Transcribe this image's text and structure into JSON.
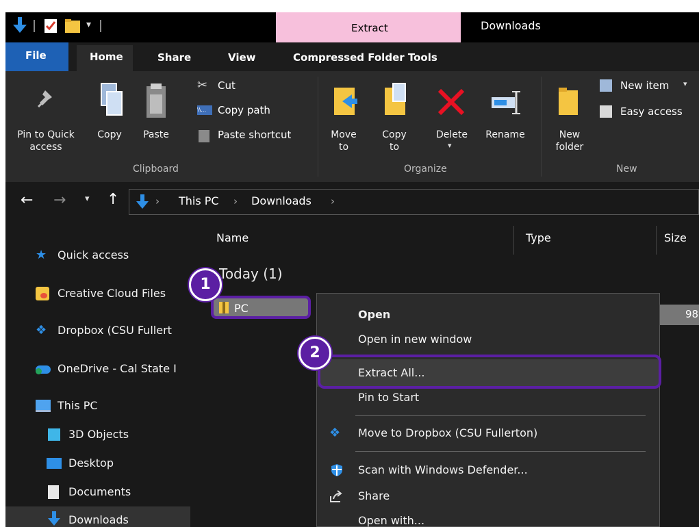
{
  "title_bar": {
    "contextual_tab": "Extract",
    "window_title": "Downloads"
  },
  "tabs": [
    "File",
    "Home",
    "Share",
    "View",
    "Compressed Folder Tools"
  ],
  "ribbon": {
    "pin_label": "Pin to Quick access",
    "copy_label": "Copy",
    "paste_label": "Paste",
    "cut_label": "Cut",
    "copy_path_label": "Copy path",
    "paste_shortcut_label": "Paste shortcut",
    "clipboard_group": "Clipboard",
    "move_to_label": "Move to",
    "copy_to_label": "Copy to",
    "delete_label": "Delete",
    "rename_label": "Rename",
    "organize_group": "Organize",
    "new_folder_label": "New folder",
    "new_item_label": "New item",
    "easy_access_label": "Easy access",
    "new_group": "New"
  },
  "address": {
    "crumbs": [
      "This PC",
      "Downloads"
    ]
  },
  "sidebar": {
    "items": [
      {
        "label": "Quick access"
      },
      {
        "label": "Creative Cloud Files"
      },
      {
        "label": "Dropbox (CSU Fullert"
      },
      {
        "label": "OneDrive - Cal State I"
      },
      {
        "label": "This PC"
      },
      {
        "label": "3D Objects"
      },
      {
        "label": "Desktop"
      },
      {
        "label": "Documents"
      },
      {
        "label": "Downloads"
      }
    ]
  },
  "file_list": {
    "columns": [
      "Name",
      "Type",
      "Size"
    ],
    "group_header": "Today (1)",
    "file_name": "PC",
    "file_size": "98,"
  },
  "context_menu": {
    "items": [
      "Open",
      "Open in new window",
      "Extract All...",
      "Pin to Start",
      "Move to Dropbox (CSU Fullerton)",
      "Scan with Windows Defender...",
      "Share",
      "Open with..."
    ]
  },
  "callouts": [
    "1",
    "2"
  ],
  "colors": {
    "accent_purple": "#5b1fa3",
    "file_tab_blue": "#1e61b5",
    "extract_tab_pink": "#f7c0dc"
  }
}
